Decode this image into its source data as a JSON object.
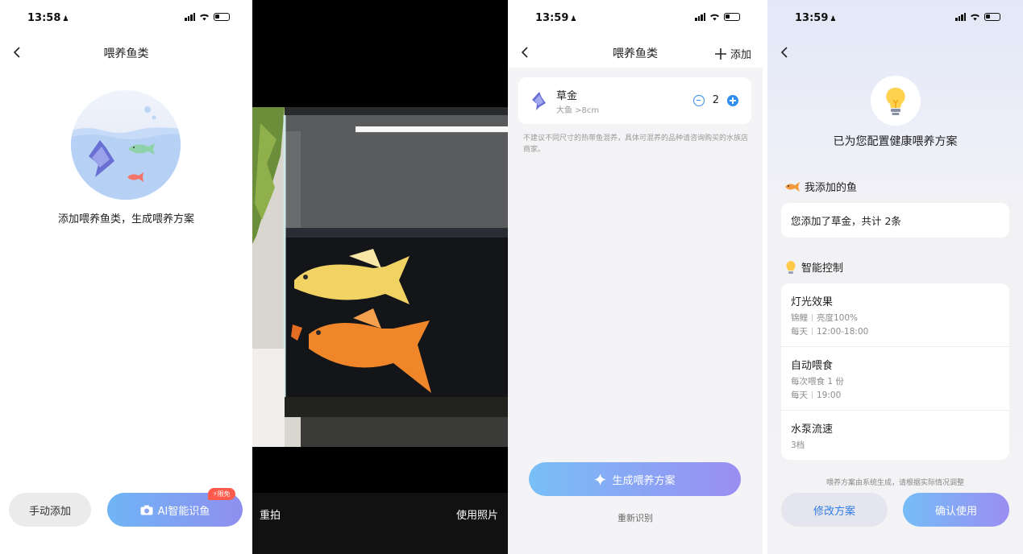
{
  "colors": {
    "accent_blue": "#2f8ef0",
    "gradient_start": "#6fb5f5",
    "gradient_end": "#9a8ef2",
    "badge_red": "#ff5a4c"
  },
  "screen1": {
    "status_time": "13:58",
    "title": "喂养鱼类",
    "hero_text": "添加喂养鱼类，生成喂养方案",
    "manual_add_label": "手动添加",
    "ai_button_label": "AI智能识鱼",
    "ai_badge": "限免"
  },
  "screen2": {
    "retake_label": "重拍",
    "use_photo_label": "使用照片"
  },
  "screen3": {
    "status_time": "13:59",
    "title": "喂养鱼类",
    "add_label": "添加",
    "fish": {
      "name": "草金",
      "size": "大鱼 >8cm",
      "quantity": "2"
    },
    "note": "不建议不同尺寸的热带鱼混养，具体可混养的品种请咨询购买的水族店商家。",
    "generate_label": "生成喂养方案",
    "reidentify_label": "重新识别"
  },
  "screen4": {
    "status_time": "13:59",
    "plan_title": "已为您配置健康喂养方案",
    "my_fish_heading": "我添加的鱼",
    "my_fish_summary": "您添加了草金，共计 2条",
    "smart_control_heading": "智能控制",
    "controls": [
      {
        "title": "灯光效果",
        "line1a": "锦鲤",
        "line1b": "亮度100%",
        "line2a": "每天",
        "line2b": "12:00-18:00"
      },
      {
        "title": "自动喂食",
        "line1a": "每次喂食 1 份",
        "line2a": "每天",
        "line2b": "19:00"
      },
      {
        "title": "水泵流速",
        "line1a": "3档"
      }
    ],
    "disclaimer": "喂养方案由系统生成，请根据实际情况调整",
    "modify_label": "修改方案",
    "confirm_label": "确认使用"
  }
}
